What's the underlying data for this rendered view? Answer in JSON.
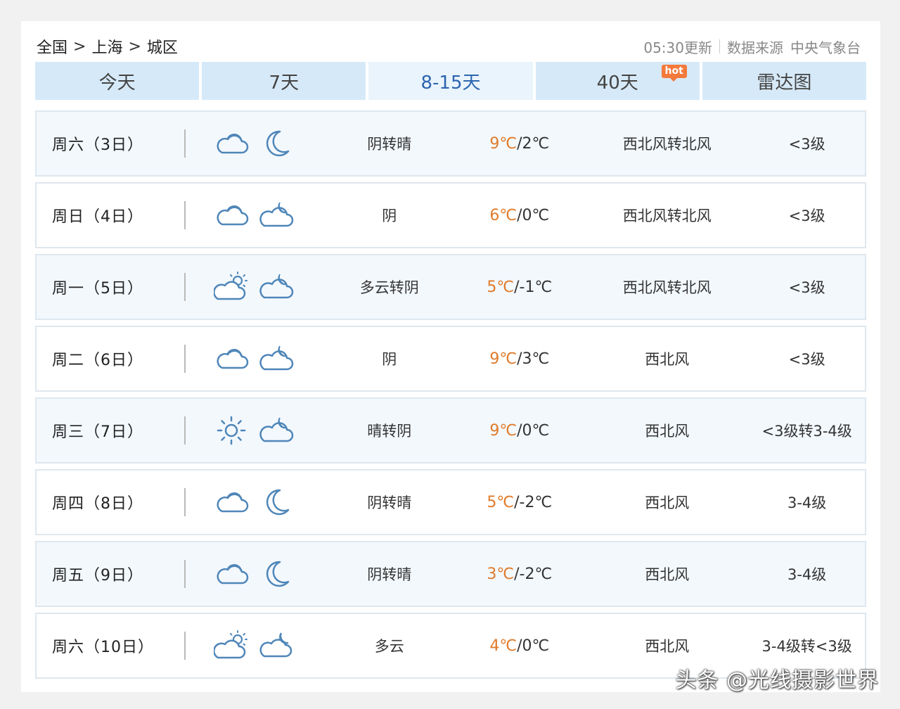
{
  "breadcrumb": {
    "country": "全国",
    "city": "上海",
    "district": "城区",
    "separator": ">"
  },
  "meta": {
    "updated": "05:30更新",
    "source_label": "数据来源",
    "source_name": "中央气象台"
  },
  "tabs": [
    {
      "label": "今天"
    },
    {
      "label": "7天"
    },
    {
      "label": "8-15天",
      "active": true
    },
    {
      "label": "40天",
      "badge": "hot"
    },
    {
      "label": "雷达图"
    }
  ],
  "forecast": [
    {
      "day": "周六（3日）",
      "day_icon": "cloudy-icon",
      "night_icon": "moon-icon",
      "condition": "阴转晴",
      "high": "9℃",
      "low": "/2℃",
      "wind": "西北风转北风",
      "level": "<3级"
    },
    {
      "day": "周日（4日）",
      "day_icon": "cloudy-icon",
      "night_icon": "night-cloudy-icon",
      "condition": "阴",
      "high": "6℃",
      "low": "/0℃",
      "wind": "西北风转北风",
      "level": "<3级"
    },
    {
      "day": "周一（5日）",
      "day_icon": "partly-cloudy-icon",
      "night_icon": "night-cloudy-icon",
      "condition": "多云转阴",
      "high": "5℃",
      "low": "/-1℃",
      "wind": "西北风转北风",
      "level": "<3级"
    },
    {
      "day": "周二（6日）",
      "day_icon": "cloudy-icon",
      "night_icon": "night-cloudy-icon",
      "condition": "阴",
      "high": "9℃",
      "low": "/3℃",
      "wind": "西北风",
      "level": "<3级"
    },
    {
      "day": "周三（7日）",
      "day_icon": "sun-icon",
      "night_icon": "night-cloudy-icon",
      "condition": "晴转阴",
      "high": "9℃",
      "low": "/0℃",
      "wind": "西北风",
      "level": "<3级转3-4级"
    },
    {
      "day": "周四（8日）",
      "day_icon": "cloudy-icon",
      "night_icon": "moon-icon",
      "condition": "阴转晴",
      "high": "5℃",
      "low": "/-2℃",
      "wind": "西北风",
      "level": "3-4级"
    },
    {
      "day": "周五（9日）",
      "day_icon": "cloudy-icon",
      "night_icon": "moon-icon",
      "condition": "阴转晴",
      "high": "3℃",
      "low": "/-2℃",
      "wind": "西北风",
      "level": "3-4级"
    },
    {
      "day": "周六（10日）",
      "day_icon": "partly-cloudy-icon",
      "night_icon": "night-partly-cloudy-icon",
      "condition": "多云",
      "high": "4℃",
      "low": "/0℃",
      "wind": "西北风",
      "level": "3-4级转<3级"
    }
  ],
  "watermark": "头条 @光线摄影世界",
  "colors": {
    "tab_bg": "#d6e9f8",
    "tab_active_text": "#2d65b0",
    "high_temp": "#e07b2a",
    "hot_badge": "#f47a3b",
    "icon_stroke": "#4f86b8"
  }
}
